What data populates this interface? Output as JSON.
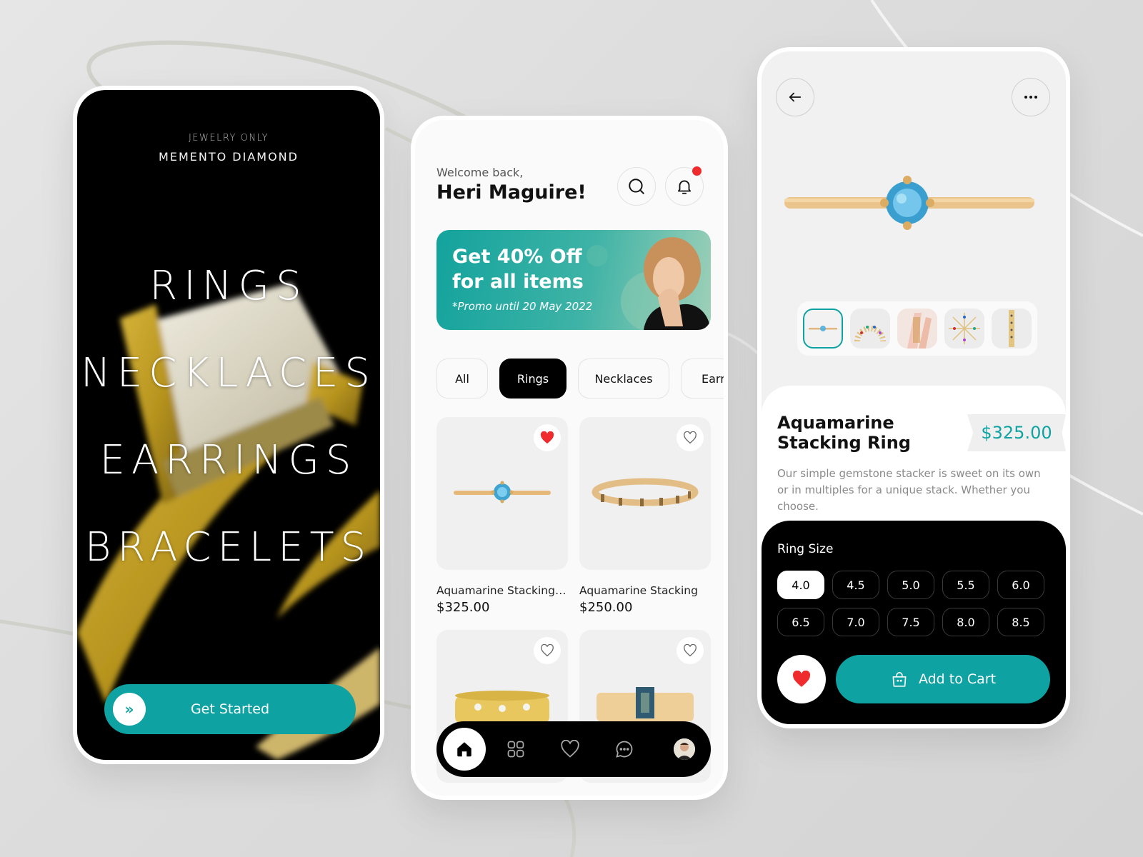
{
  "colors": {
    "accent": "#0ea3a2",
    "notification": "#ef2b2d",
    "favorite": "#ef2b2d",
    "dark": "#000000"
  },
  "splash": {
    "brand_subtitle": "JEWELRY ONLY",
    "brand_title": "MEMENTO DIAMOND",
    "categories": [
      "RINGS",
      "NECKLACES",
      "EARRINGS",
      "BRACELETS"
    ],
    "cta_label": "Get Started",
    "cta_icon": "double-chevron-right-icon"
  },
  "home": {
    "greeting": "Welcome back,",
    "username": "Heri Maguire!",
    "search_icon": "search-icon",
    "notification_icon": "bell-icon",
    "promo": {
      "title_line1": "Get 40% Off",
      "title_line2": "for all items",
      "subtitle": "*Promo until 20 May 2022"
    },
    "categories": [
      {
        "label": "All",
        "active": false
      },
      {
        "label": "Rings",
        "active": true
      },
      {
        "label": "Necklaces",
        "active": false
      },
      {
        "label": "Earrings",
        "active": false
      }
    ],
    "products": [
      {
        "name": "Aquamarine Stacking Ring",
        "price": "$325.00",
        "favorited": true
      },
      {
        "name": "Aquamarine Stacking",
        "price": "$250.00",
        "favorited": false
      },
      {
        "name": "",
        "price": "",
        "favorited": false
      },
      {
        "name": "",
        "price": "",
        "favorited": false
      }
    ],
    "nav": [
      "home-icon",
      "grid-icon",
      "heart-icon",
      "chat-icon",
      "avatar"
    ]
  },
  "detail": {
    "back_icon": "arrow-left-icon",
    "more_icon": "more-horizontal-icon",
    "thumbnails": 5,
    "active_thumbnail": 0,
    "name_line1": "Aquamarine",
    "name_line2": "Stacking Ring",
    "price": "$325.00",
    "description": "Our simple gemstone stacker is sweet on its own or in multiples for a unique stack. Whether you choose.",
    "size_label": "Ring Size",
    "sizes": [
      "4.0",
      "4.5",
      "5.0",
      "5.5",
      "6.0",
      "6.5",
      "7.0",
      "7.5",
      "8.0",
      "8.5"
    ],
    "selected_size": "4.0",
    "favorited": true,
    "add_to_cart_label": "Add to Cart"
  }
}
